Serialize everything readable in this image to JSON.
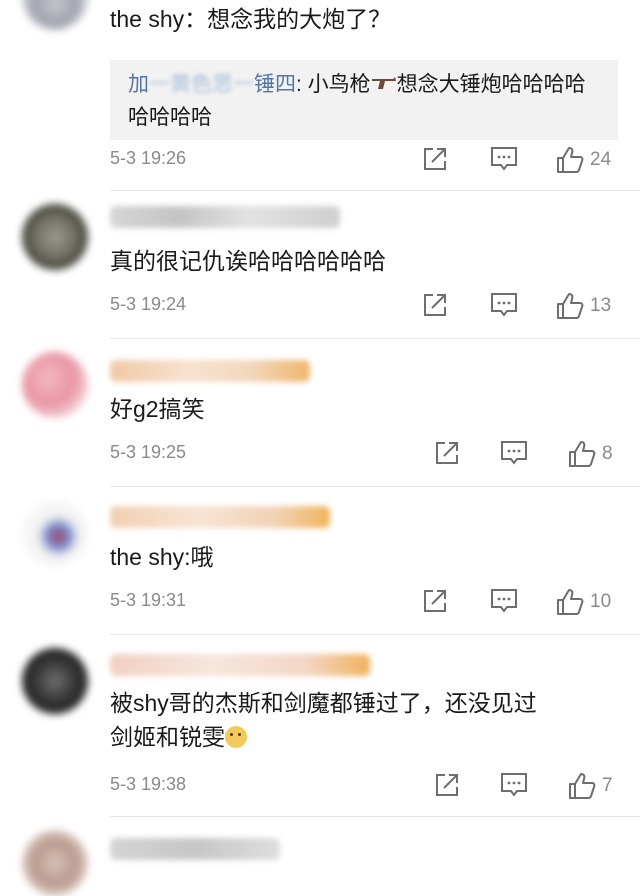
{
  "comments": [
    {
      "text": "the shy：想念我的大炮了？",
      "reply": {
        "author_visible": "加",
        "author_blur": "一黄色思一",
        "author_tail": "锤四",
        "text_before": ": 小鸟枪",
        "text_after": "想念大锤炮哈哈哈哈哈哈哈哈"
      },
      "time": "5-3 19:26",
      "likes": "24"
    },
    {
      "text": "真的很记仇诶哈哈哈哈哈哈",
      "time": "5-3 19:24",
      "likes": "13"
    },
    {
      "text": "好g2搞笑",
      "time": "5-3 19:25",
      "likes": "8"
    },
    {
      "text": "the shy:哦",
      "time": "5-3 19:31",
      "likes": "10"
    },
    {
      "text_line1": "被shy哥的杰斯和剑魔都锤过了，还没见过",
      "text_line2": "剑姬和锐雯",
      "time": "5-3 19:38",
      "likes": "7"
    }
  ],
  "icons": {
    "share": "share-icon",
    "comment": "comment-icon",
    "like": "thumbs-up-icon"
  },
  "colors": {
    "text": "#1a1a1a",
    "meta": "#8a8a8a",
    "reply_bg": "#f2f2f2",
    "reply_name": "#5276a8",
    "divider": "#e6e6e6"
  }
}
